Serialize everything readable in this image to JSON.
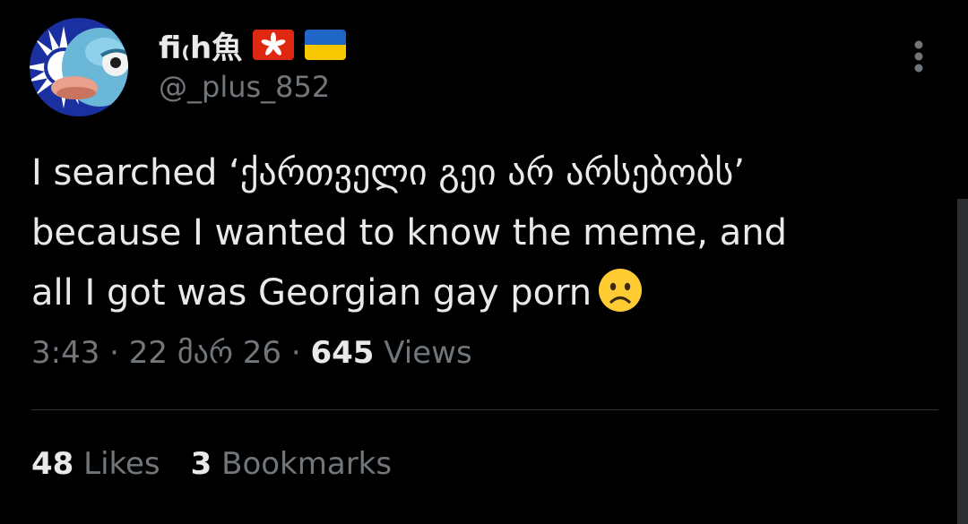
{
  "author": {
    "display_name": "fi₍h魚",
    "handle": "@_plus_852",
    "flags": [
      "hong-kong-flag-icon",
      "ukraine-flag-icon"
    ]
  },
  "tweet": {
    "lines": [
      "I searched ‘ქართველი გეი არ არსებობს’",
      "because I wanted to know the meme, and",
      "all I got was Georgian gay porn"
    ],
    "emoji": "frowning-face-emoji"
  },
  "meta": {
    "time": "3:43",
    "date": "22 მარ 26",
    "views_count": "645",
    "views_label": "Views",
    "separator": "·"
  },
  "stats": {
    "likes_count": "48",
    "likes_label": "Likes",
    "bookmarks_count": "3",
    "bookmarks_label": "Bookmarks"
  },
  "colors": {
    "background": "#000000",
    "primary_text": "#e7e9ea",
    "secondary_text": "#71767b",
    "divider": "#2f3336"
  }
}
